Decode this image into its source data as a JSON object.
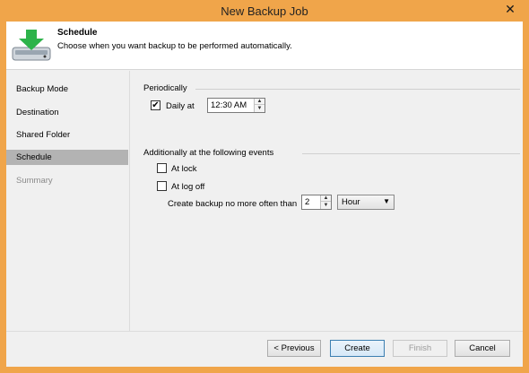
{
  "window": {
    "title": "New Backup Job",
    "close_glyph": "✕"
  },
  "header": {
    "title": "Schedule",
    "description": "Choose when you want backup to be performed automatically.",
    "icon": "drive-download-icon"
  },
  "nav": {
    "items": [
      {
        "label": "Backup Mode",
        "state": "normal"
      },
      {
        "label": "Destination",
        "state": "normal"
      },
      {
        "label": "Shared Folder",
        "state": "normal"
      },
      {
        "label": "Schedule",
        "state": "selected"
      },
      {
        "label": "Summary",
        "state": "disabled"
      }
    ]
  },
  "periodically": {
    "group_label": "Periodically",
    "daily": {
      "label": "Daily at",
      "checked": true
    },
    "time_value": "12:30 AM"
  },
  "events": {
    "group_label": "Additionally at the following events",
    "at_lock": {
      "label": "At lock",
      "checked": false
    },
    "at_logoff": {
      "label": "At log off",
      "checked": false
    },
    "frequency_label": "Create backup no more often than",
    "frequency_value": "2",
    "unit_value": "Hour"
  },
  "buttons": {
    "previous": "< Previous",
    "create": "Create",
    "finish": "Finish",
    "cancel": "Cancel"
  },
  "colors": {
    "frame": "#f0a54a",
    "selection": "#b3b3b3",
    "dialog_bg": "#f0f0f0",
    "icon_green": "#2db34a"
  }
}
